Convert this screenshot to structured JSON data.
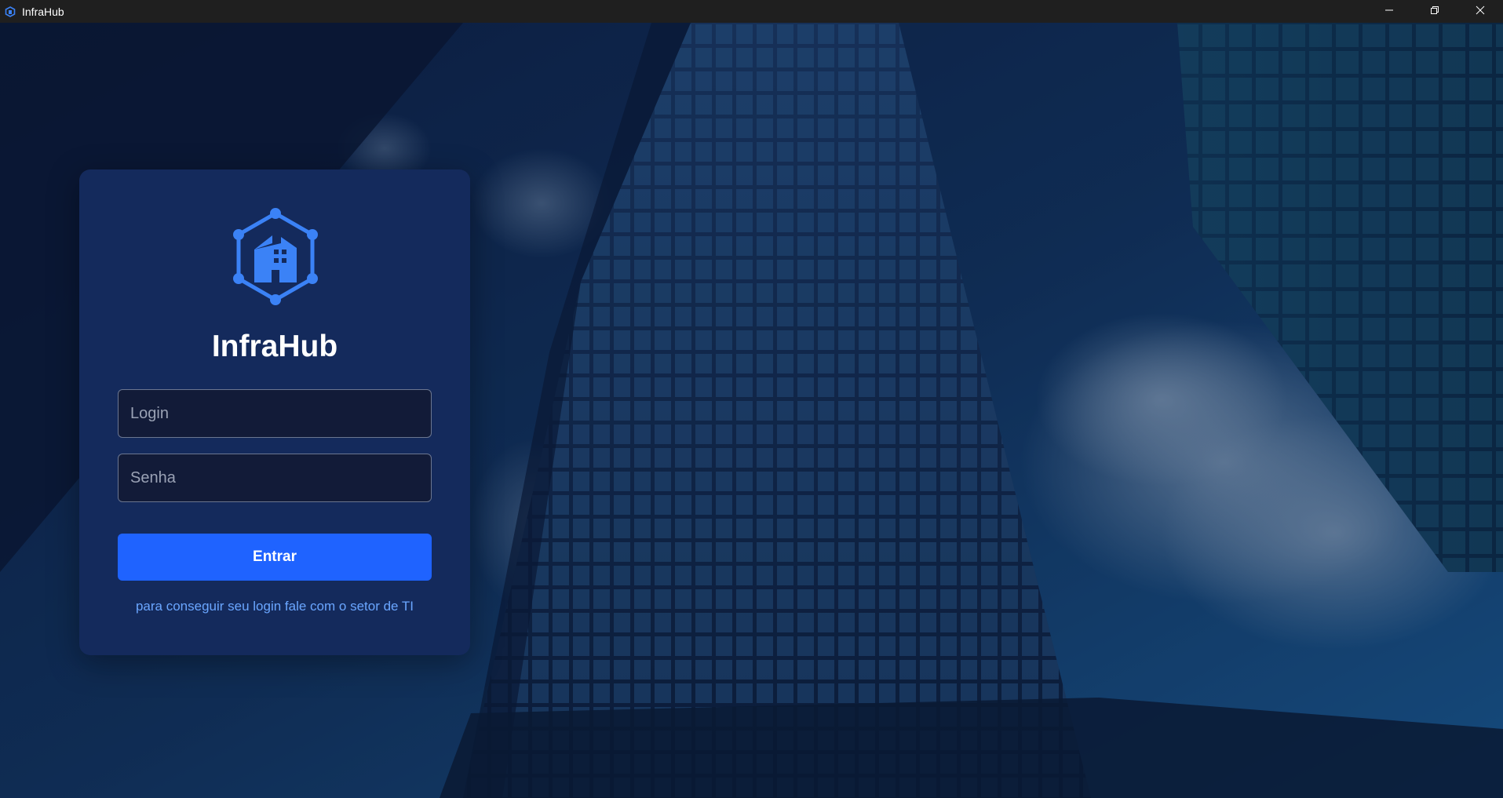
{
  "window": {
    "title": "InfraHub",
    "icon": "app-hexagon-icon",
    "controls": [
      "minimize-icon",
      "restore-icon",
      "close-icon"
    ]
  },
  "login_card": {
    "logo": "building-hexagon-logo",
    "app_name": "InfraHub",
    "login_placeholder": "Login",
    "login_value": "",
    "password_placeholder": "Senha",
    "password_value": "",
    "submit_label": "Entrar",
    "help_text": "para conseguir seu login fale com o setor de TI"
  },
  "colors": {
    "card_background": "#142a5c",
    "accent": "#1f63ff",
    "logo": "#3b82f6",
    "link_text": "#6aa6ff"
  }
}
